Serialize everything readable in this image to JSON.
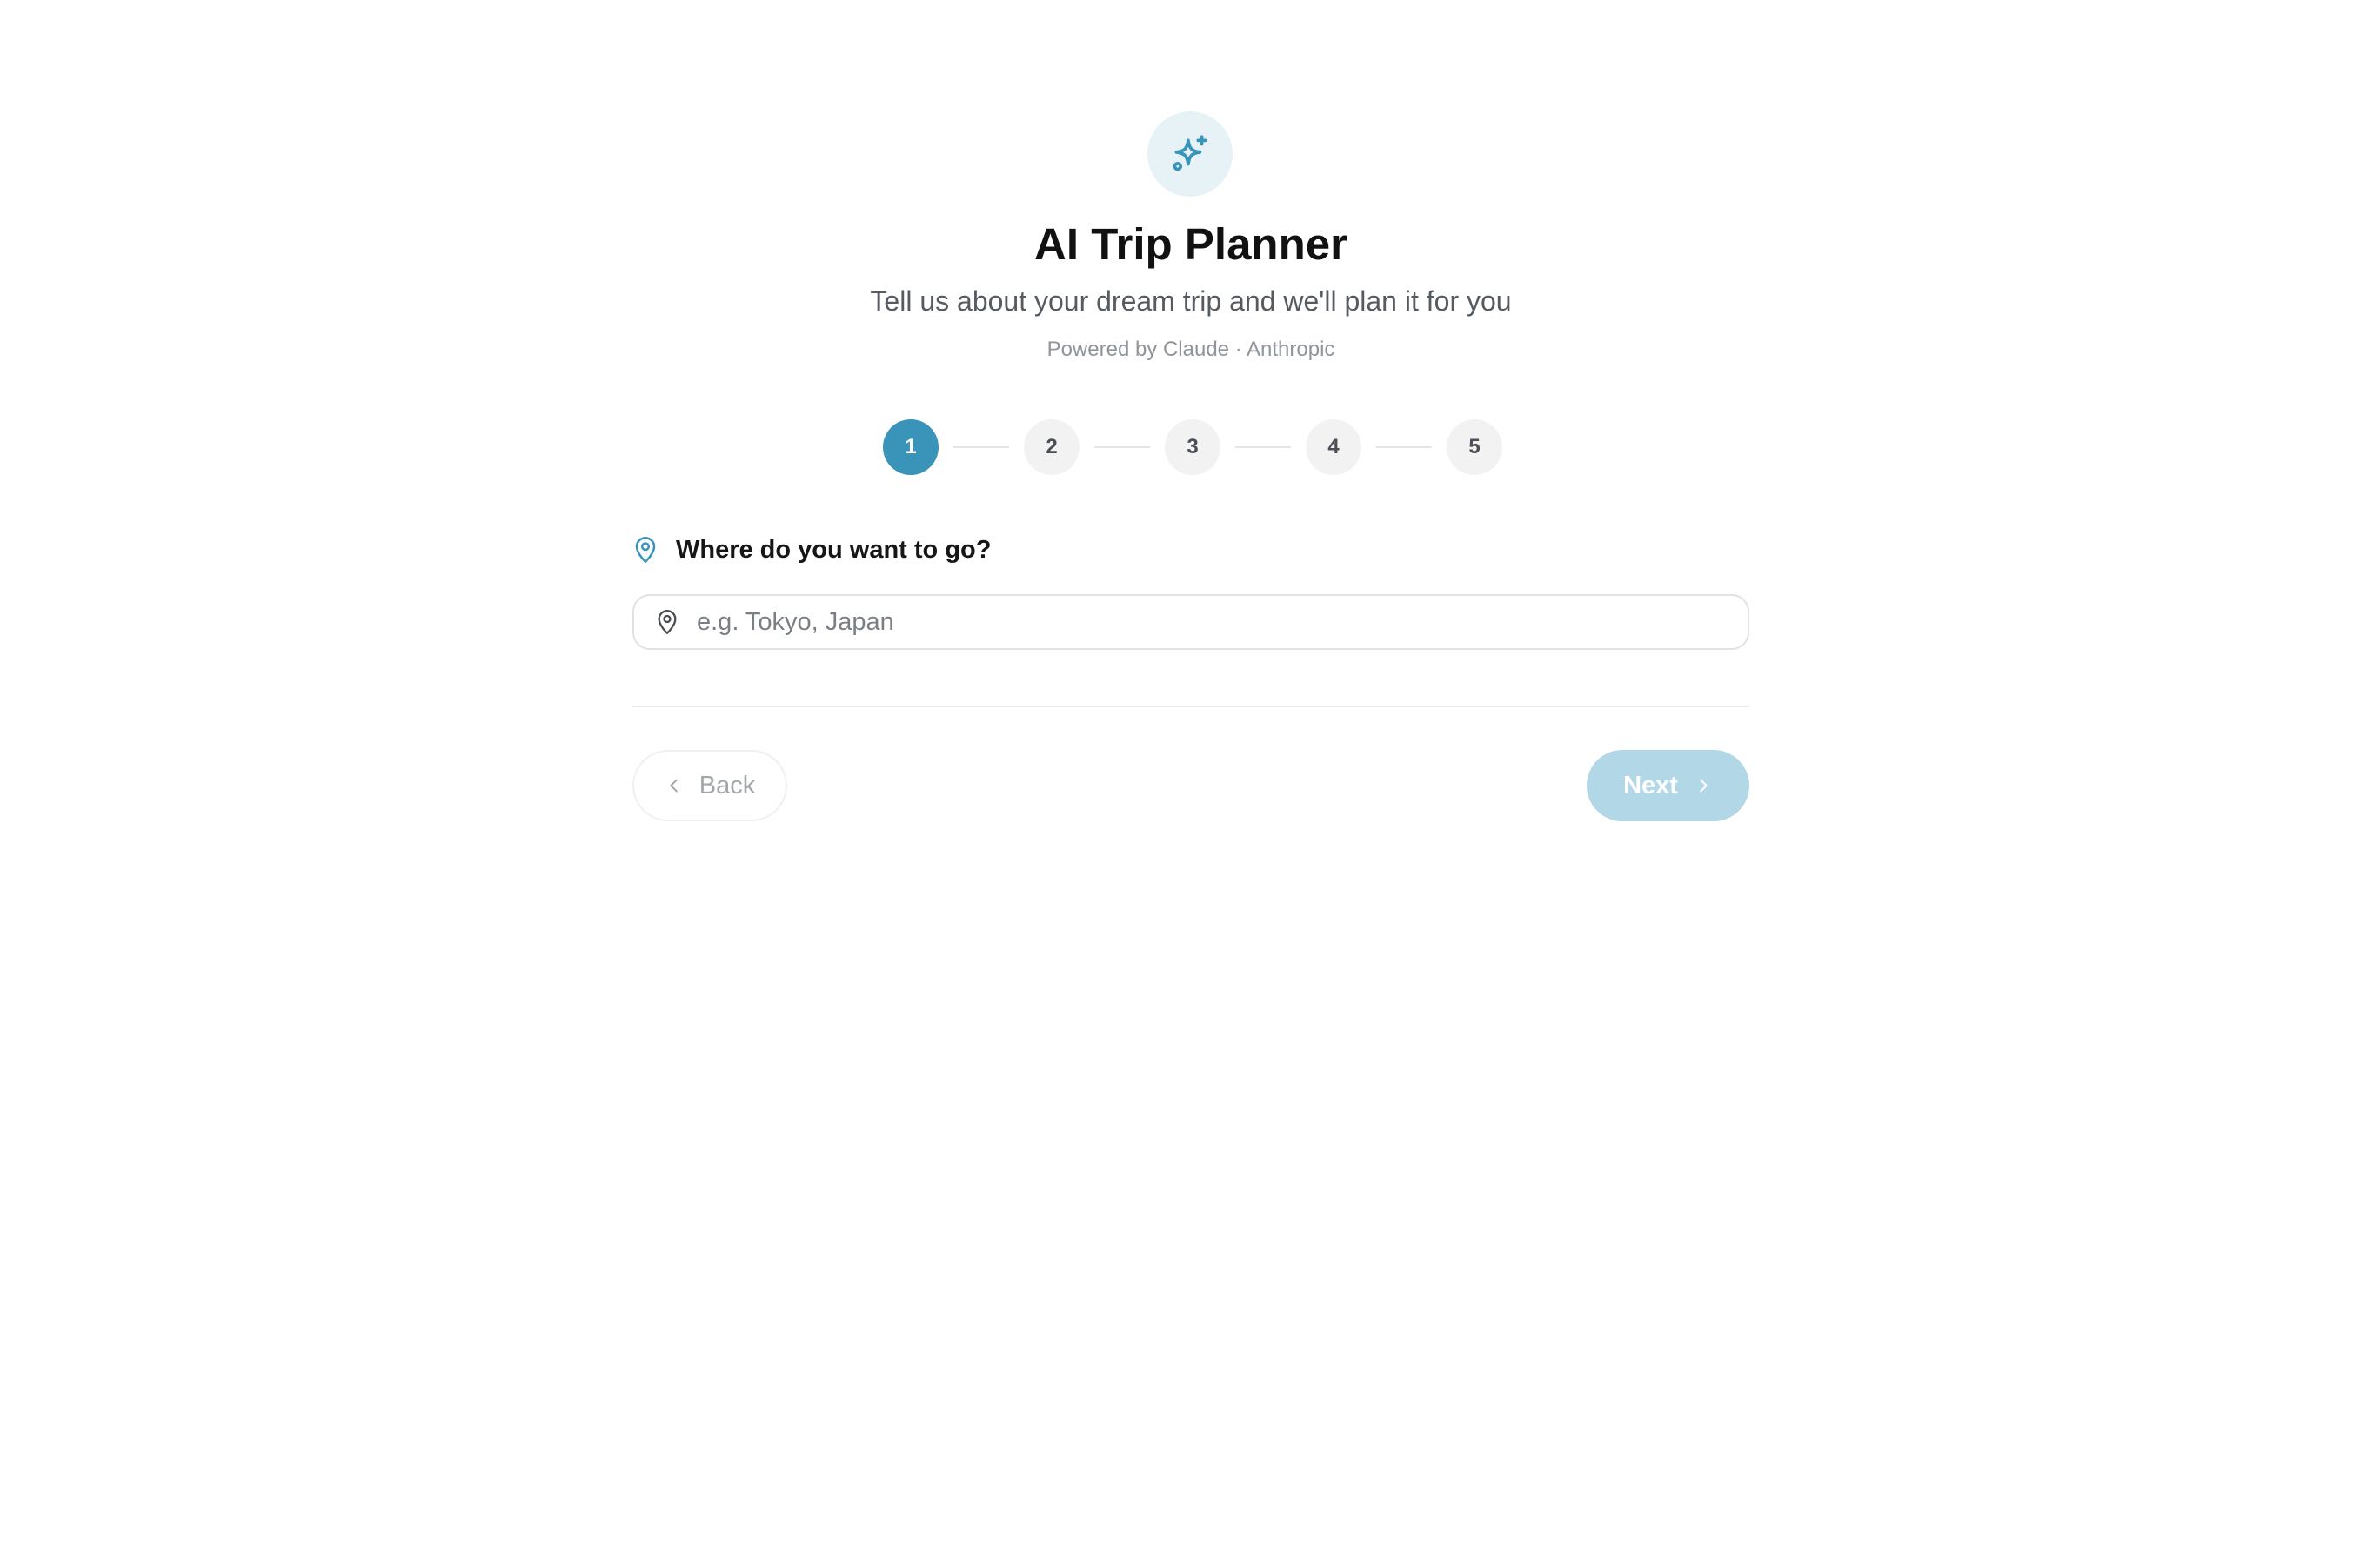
{
  "header": {
    "icon": "sparkles-icon",
    "title": "AI Trip Planner",
    "subtitle": "Tell us about your dream trip and we'll plan it for you",
    "powered_by": "Powered by Claude · Anthropic"
  },
  "stepper": {
    "current_step": 1,
    "steps": [
      "1",
      "2",
      "3",
      "4",
      "5"
    ]
  },
  "question": {
    "icon": "map-pin-icon",
    "label": "Where do you want to go?"
  },
  "destination_input": {
    "icon": "map-pin-icon",
    "value": "",
    "placeholder": "e.g. Tokyo, Japan"
  },
  "navigation": {
    "back_label": "Back",
    "next_label": "Next"
  },
  "colors": {
    "accent": "#3a93b8",
    "accent_light": "#e7f2f7",
    "next_disabled": "#b2d7e6"
  }
}
